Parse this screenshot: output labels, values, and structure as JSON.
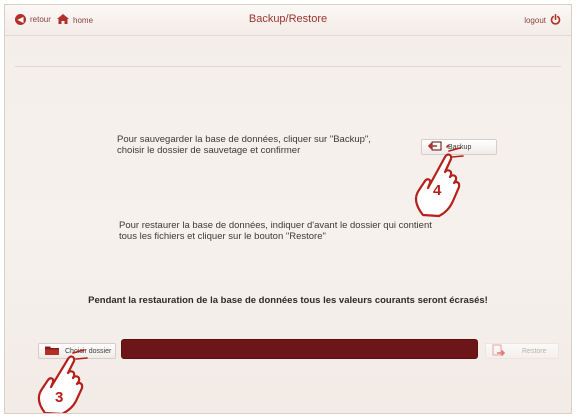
{
  "header": {
    "back_label": "retour",
    "home_label": "home",
    "title": "Backup/Restore",
    "logout_label": "logout"
  },
  "backup": {
    "instruction_line1": "Pour sauvegarder la base de données, cliquer sur \"Backup\",",
    "instruction_line2": "choisir le dossier de sauvetage et confirmer",
    "button_label": "Backup"
  },
  "restore": {
    "instruction_line1": "Pour restaurer la base de données, indiquer d'avant le dossier qui contient",
    "instruction_line2": "tous les fichiers et cliquer sur le bouton \"Restore\"",
    "warning": "Pendant la restauration de la base de données tous les valeurs courants seront écrasés!",
    "choose_folder_label": "Choisir dossier",
    "folder_path_value": "",
    "restore_label": "Restore",
    "restore_enabled": false
  },
  "annotations": {
    "step_backup": "4",
    "step_choose_folder": "3"
  },
  "colors": {
    "accent": "#9b332c",
    "path_bar": "#6d1619",
    "annotation": "#b61f1a"
  },
  "icons": {
    "back": "back-arrow-circle-icon",
    "home": "home-icon",
    "logout": "power-icon",
    "backup": "backup-arrow-icon",
    "folder": "folder-icon",
    "restore": "restore-icon",
    "hand": "hand-pointer-icon"
  }
}
